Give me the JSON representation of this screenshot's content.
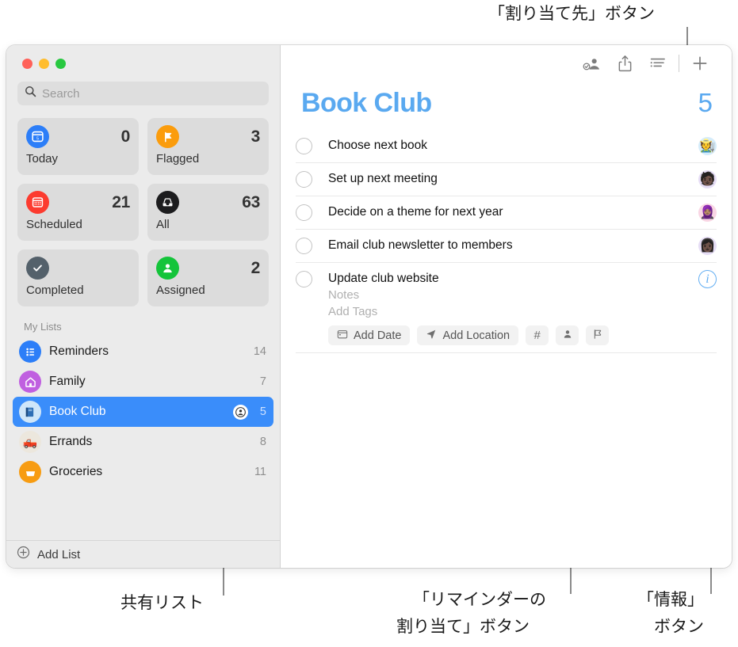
{
  "annotations": [
    {
      "id": "assign_to_button",
      "text": "「割り当て先」ボタン"
    },
    {
      "id": "shared_list",
      "text": "共有リスト"
    },
    {
      "id": "assign_reminder_button_l1",
      "text": "「リマインダーの"
    },
    {
      "id": "assign_reminder_button_l2",
      "text": "割り当て」ボタン"
    },
    {
      "id": "info_button_l1",
      "text": "「情報」"
    },
    {
      "id": "info_button_l2",
      "text": "ボタン"
    }
  ],
  "window": {
    "traffic_lights": [
      "close",
      "minimize",
      "zoom"
    ]
  },
  "sidebar": {
    "search": {
      "placeholder": "Search",
      "value": "",
      "icon": "search-icon"
    },
    "smart_lists": [
      {
        "label": "Today",
        "count": "0",
        "icon": "today-icon",
        "color": "#2c7ef8"
      },
      {
        "label": "Flagged",
        "count": "3",
        "icon": "flag-icon",
        "color": "#fb9c0c"
      },
      {
        "label": "Scheduled",
        "count": "21",
        "icon": "calendar-icon",
        "color": "#fc3b2f"
      },
      {
        "label": "All",
        "count": "63",
        "icon": "inbox-icon",
        "color": "#1c1c1e"
      },
      {
        "label": "Completed",
        "count": "",
        "icon": "check-icon",
        "color": "#54616b"
      },
      {
        "label": "Assigned",
        "count": "2",
        "icon": "person-icon",
        "color": "#14c43a"
      }
    ],
    "my_lists_header": "My Lists",
    "lists": [
      {
        "name": "Reminders",
        "count": "14",
        "icon": "bullet-list-icon",
        "color": "#2c7ef8",
        "glyph": "",
        "shared": false,
        "selected": false
      },
      {
        "name": "Family",
        "count": "7",
        "icon": "house-icon",
        "color": "#c05fe0",
        "glyph": "",
        "shared": false,
        "selected": false
      },
      {
        "name": "Book Club",
        "count": "5",
        "icon": "book-icon",
        "color": "#cfe6f9",
        "glyph": "📘",
        "shared": true,
        "selected": true
      },
      {
        "name": "Errands",
        "count": "8",
        "icon": "truck-icon",
        "color": "#ece7dd",
        "glyph": "🛻",
        "shared": false,
        "selected": false
      },
      {
        "name": "Groceries",
        "count": "11",
        "icon": "basket-icon",
        "color": "#f79c12",
        "glyph": "🧺",
        "shared": false,
        "selected": false
      }
    ],
    "add_list": {
      "label": "Add List",
      "icon": "plus-circle-icon"
    }
  },
  "toolbar": {
    "buttons": [
      {
        "name": "assign-to-button",
        "icon": "person-badge-check-icon"
      },
      {
        "name": "share-button",
        "icon": "share-icon"
      },
      {
        "name": "list-options-button",
        "icon": "list-lines-icon"
      },
      {
        "name": "add-reminder-button",
        "icon": "plus-icon"
      }
    ]
  },
  "main": {
    "title": "Book Club",
    "total": "5",
    "accent": "#5aa9f0",
    "reminders": [
      {
        "title": "Choose next book",
        "avatar": "🧑‍🌾",
        "avatar_bg": "#d5ecfa",
        "expanded": false
      },
      {
        "title": "Set up next meeting",
        "avatar": "🧑🏿",
        "avatar_bg": "#e6ddf5",
        "expanded": false
      },
      {
        "title": "Decide on a theme for next year",
        "avatar": "🧕🏽",
        "avatar_bg": "#f9d6e4",
        "expanded": false
      },
      {
        "title": "Email club newsletter to members",
        "avatar": "👩🏿",
        "avatar_bg": "#e6ddf5",
        "expanded": false
      },
      {
        "title": "Update club website",
        "avatar": "",
        "avatar_bg": "",
        "expanded": true,
        "notes_placeholder": "Notes",
        "tags_placeholder": "Add Tags",
        "actions": [
          {
            "label": "Add Date",
            "icon": "calendar-small-icon",
            "name": "add-date-button"
          },
          {
            "label": "Add Location",
            "icon": "location-arrow-icon",
            "name": "add-location-button"
          },
          {
            "label": "#",
            "icon": "tag-hash-icon",
            "name": "add-tag-button"
          },
          {
            "label": "",
            "icon": "person-assign-icon",
            "name": "assign-reminder-button"
          },
          {
            "label": "",
            "icon": "flag-outline-icon",
            "name": "flag-button"
          }
        ]
      }
    ]
  }
}
